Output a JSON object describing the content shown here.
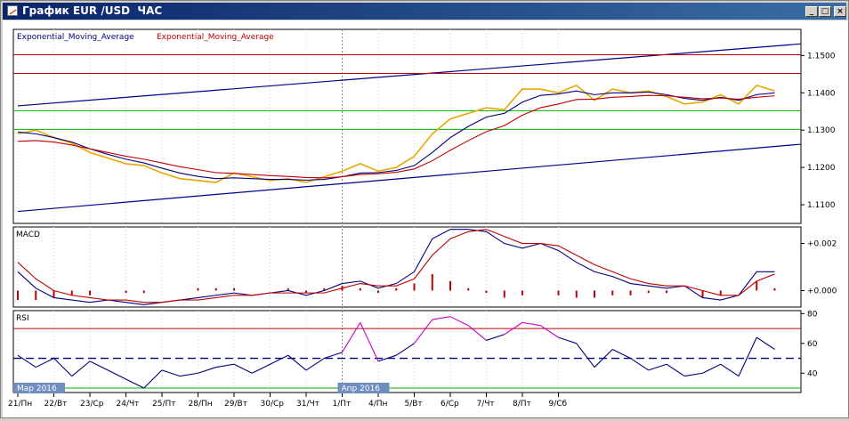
{
  "window": {
    "title": "График EUR /USD  ЧАС",
    "min_glyph": "_",
    "max_glyph": "□",
    "close_glyph": "×"
  },
  "chart_data": [
    {
      "type": "line",
      "pane": "price",
      "legend": [
        {
          "text": "Exponential_Moving_Average",
          "color": "#000080"
        },
        {
          "text": "Exponential_Moving_Average",
          "color": "#c00000"
        }
      ],
      "ylim": [
        1.105,
        1.157
      ],
      "yticks": [
        1.11,
        1.12,
        1.13,
        1.14,
        1.15
      ],
      "ytick_labels": [
        "1.1100",
        "1.1200",
        "1.1300",
        "1.1400",
        "1.1500"
      ],
      "colors": {
        "price": "#e8a800",
        "ema_fast": "#000080",
        "ema_slow": "#c00000",
        "channel": "#00008b",
        "resistance": "#c00000",
        "support": "#00b000"
      },
      "horizontal_lines": [
        {
          "y": 1.1502,
          "color": "#c00000"
        },
        {
          "y": 1.1452,
          "color": "#c00000"
        },
        {
          "y": 1.1352,
          "color": "#00b000"
        },
        {
          "y": 1.1302,
          "color": "#00b000"
        }
      ],
      "trendlines": [
        {
          "x": [
            0,
            157
          ],
          "y": [
            1.1365,
            1.1565
          ],
          "color": "#00008b"
        },
        {
          "x": [
            0,
            157
          ],
          "y": [
            1.1082,
            1.1299
          ],
          "color": "#00008b"
        }
      ],
      "x": [
        0,
        3,
        6,
        9,
        12,
        15,
        18,
        21,
        24,
        27,
        30,
        33,
        36,
        39,
        42,
        45,
        48,
        51,
        54,
        57,
        60,
        63,
        66,
        69,
        72,
        75,
        78,
        81,
        84,
        87,
        90,
        93,
        96,
        99,
        102,
        105,
        108,
        111,
        114,
        117,
        120,
        123,
        126
      ],
      "series": [
        {
          "name": "EUR/USD",
          "values": [
            1.129,
            1.13,
            1.128,
            1.1265,
            1.124,
            1.1225,
            1.121,
            1.1205,
            1.1185,
            1.117,
            1.1165,
            1.116,
            1.1185,
            1.1175,
            1.1165,
            1.117,
            1.116,
            1.1175,
            1.119,
            1.121,
            1.119,
            1.12,
            1.123,
            1.129,
            1.133,
            1.1345,
            1.136,
            1.1355,
            1.141,
            1.141,
            1.14,
            1.142,
            1.138,
            1.141,
            1.14,
            1.1405,
            1.139,
            1.137,
            1.1375,
            1.1395,
            1.137,
            1.142,
            1.1405
          ]
        },
        {
          "name": "EMA fast",
          "values": [
            1.1295,
            1.129,
            1.128,
            1.1268,
            1.125,
            1.1235,
            1.1222,
            1.1212,
            1.1198,
            1.1185,
            1.1176,
            1.117,
            1.1172,
            1.117,
            1.1168,
            1.1168,
            1.1166,
            1.1168,
            1.1175,
            1.1185,
            1.1186,
            1.1192,
            1.1205,
            1.124,
            1.128,
            1.131,
            1.1335,
            1.1345,
            1.1375,
            1.1393,
            1.1397,
            1.1405,
            1.1395,
            1.14,
            1.14,
            1.1402,
            1.1395,
            1.1385,
            1.138,
            1.1388,
            1.138,
            1.1395,
            1.14
          ]
        },
        {
          "name": "EMA slow",
          "values": [
            1.127,
            1.1272,
            1.1268,
            1.126,
            1.125,
            1.124,
            1.123,
            1.1222,
            1.1212,
            1.1202,
            1.1194,
            1.1186,
            1.1184,
            1.1181,
            1.1178,
            1.1176,
            1.1173,
            1.1172,
            1.1175,
            1.1181,
            1.1183,
            1.1187,
            1.1196,
            1.1218,
            1.1246,
            1.1272,
            1.1296,
            1.1312,
            1.134,
            1.136,
            1.137,
            1.1382,
            1.1383,
            1.1388,
            1.139,
            1.1393,
            1.1392,
            1.1388,
            1.1384,
            1.1386,
            1.1383,
            1.1388,
            1.1392
          ]
        }
      ]
    },
    {
      "type": "line",
      "pane": "macd",
      "title": "MACD",
      "ylim": [
        -0.0007,
        0.0027
      ],
      "yticks": [
        0.002,
        0.0
      ],
      "ytick_labels": [
        "+0.002",
        "+0.000"
      ],
      "x": [
        0,
        3,
        6,
        9,
        12,
        15,
        18,
        21,
        24,
        27,
        30,
        33,
        36,
        39,
        42,
        45,
        48,
        51,
        54,
        57,
        60,
        63,
        66,
        69,
        72,
        75,
        78,
        81,
        84,
        87,
        90,
        93,
        96,
        99,
        102,
        105,
        108,
        111,
        114,
        117,
        120,
        123,
        126
      ],
      "series": [
        {
          "name": "MACD",
          "color": "#000080",
          "values": [
            0.0008,
            0.0001,
            -0.0003,
            -0.0004,
            -0.0005,
            -0.0004,
            -0.0005,
            -0.0006,
            -0.0005,
            -0.0004,
            -0.0003,
            -0.0002,
            -0.0001,
            -0.0002,
            -0.0001,
            0.0,
            -0.0002,
            0.0,
            0.0003,
            0.0004,
            0.0001,
            0.0003,
            0.0008,
            0.0022,
            0.0026,
            0.0026,
            0.0025,
            0.002,
            0.0018,
            0.002,
            0.0017,
            0.0012,
            0.0008,
            0.0006,
            0.0003,
            0.0002,
            0.0001,
            0.0002,
            -0.0003,
            -0.0004,
            -0.0002,
            0.0008,
            0.0008
          ]
        },
        {
          "name": "Signal",
          "color": "#c00000",
          "values": [
            0.0012,
            0.0005,
            0.0,
            -0.0002,
            -0.0003,
            -0.0004,
            -0.0004,
            -0.0005,
            -0.0005,
            -0.0004,
            -0.0004,
            -0.0003,
            -0.0002,
            -0.0002,
            -0.0001,
            -0.0001,
            -0.0001,
            -0.0001,
            0.0001,
            0.0003,
            0.0002,
            0.0002,
            0.0005,
            0.0015,
            0.0022,
            0.0025,
            0.0026,
            0.0023,
            0.002,
            0.002,
            0.0019,
            0.0015,
            0.0011,
            0.0008,
            0.0005,
            0.0003,
            0.0002,
            0.0002,
            0.0,
            -0.0002,
            -0.0002,
            0.0004,
            0.0007
          ]
        },
        {
          "name": "Histogram",
          "color": "#c00000",
          "values": [
            -0.0004,
            -0.0004,
            -0.0003,
            -0.0002,
            -0.0002,
            0.0,
            -0.0001,
            -0.0001,
            0.0,
            0.0,
            0.0001,
            0.0001,
            0.0001,
            0.0,
            0.0,
            0.0001,
            -0.0001,
            0.0001,
            0.0002,
            0.0001,
            -0.0001,
            0.0001,
            0.0003,
            0.0007,
            0.0004,
            0.0001,
            -0.0001,
            -0.0003,
            -0.0002,
            0.0,
            -0.0002,
            -0.0003,
            -0.0003,
            -0.0002,
            -0.0002,
            -0.0001,
            -0.0001,
            0.0,
            -0.0003,
            -0.0002,
            0.0,
            0.0004,
            0.0001
          ]
        }
      ]
    },
    {
      "type": "line",
      "pane": "rsi",
      "title": "RSI",
      "ylim": [
        27,
        82
      ],
      "yticks": [
        80,
        60,
        40
      ],
      "ytick_labels": [
        "80",
        "60",
        "40"
      ],
      "levels": [
        {
          "y": 70,
          "color": "#c00000"
        },
        {
          "y": 50,
          "color": "#000080",
          "dashed": true
        },
        {
          "y": 30,
          "color": "#00b000"
        }
      ],
      "x": [
        0,
        3,
        6,
        9,
        12,
        15,
        18,
        21,
        24,
        27,
        30,
        33,
        36,
        39,
        42,
        45,
        48,
        51,
        54,
        57,
        60,
        63,
        66,
        69,
        72,
        75,
        78,
        81,
        84,
        87,
        90,
        93,
        96,
        99,
        102,
        105,
        108,
        111,
        114,
        117,
        120,
        123,
        126
      ],
      "series": [
        {
          "name": "RSI",
          "color": "#000080",
          "overbought_color": "#cc00cc",
          "oversold_color": "#00a000",
          "values": [
            52,
            44,
            50,
            38,
            48,
            42,
            36,
            30,
            42,
            38,
            40,
            44,
            46,
            40,
            46,
            52,
            42,
            50,
            54,
            74,
            48,
            52,
            60,
            76,
            78,
            72,
            62,
            66,
            74,
            72,
            64,
            60,
            44,
            56,
            50,
            42,
            46,
            38,
            40,
            46,
            38,
            64,
            56
          ]
        }
      ]
    }
  ],
  "time_axis": {
    "ticks": [
      {
        "x": 0,
        "label": "21/Пн"
      },
      {
        "x": 6,
        "label": "22/Вт"
      },
      {
        "x": 12,
        "label": "23/Ср"
      },
      {
        "x": 18,
        "label": "24/Чт"
      },
      {
        "x": 24,
        "label": "25/Пт"
      },
      {
        "x": 30,
        "label": "28/Пн"
      },
      {
        "x": 36,
        "label": "29/Вт"
      },
      {
        "x": 42,
        "label": "30/Ср"
      },
      {
        "x": 48,
        "label": "31/Чт"
      },
      {
        "x": 54,
        "label": "1/Пт"
      },
      {
        "x": 60,
        "label": "4/Пн"
      },
      {
        "x": 66,
        "label": "5/Вт"
      },
      {
        "x": 72,
        "label": "6/Ср"
      },
      {
        "x": 78,
        "label": "7/Чт"
      },
      {
        "x": 84,
        "label": "8/Пт"
      },
      {
        "x": 90,
        "label": "9/Сб"
      }
    ],
    "month_labels": [
      {
        "x": 0,
        "label": "Мар 2016"
      },
      {
        "x": 54,
        "label": "Апр 2016"
      }
    ],
    "cursor_x": 54
  }
}
